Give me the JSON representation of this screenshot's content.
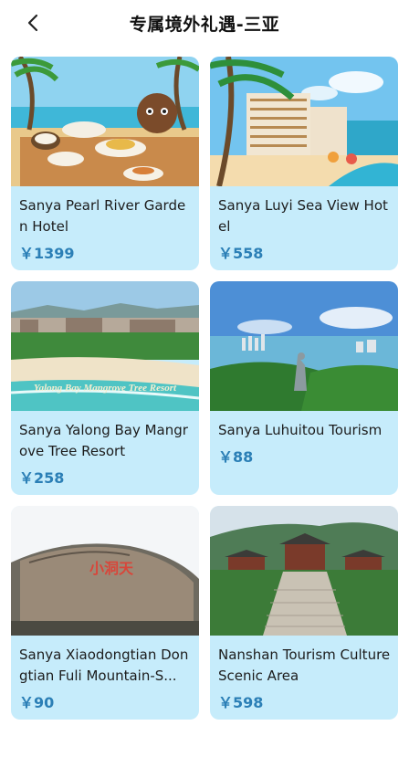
{
  "header": {
    "title": "专属境外礼遇-三亚"
  },
  "colors": {
    "card_bg": "#c6ecfb",
    "price": "#2b7fb6"
  },
  "hotels": [
    {
      "name": "Sanya Pearl River Garden Hotel",
      "price": "￥1399"
    },
    {
      "name": "Sanya Luyi Sea View Hotel",
      "price": "￥558"
    },
    {
      "name": "Sanya Yalong Bay Mangrove Tree Resort",
      "price": "￥258",
      "image_text": "Yalong Bay Mangrove Tree Resort"
    },
    {
      "name": "Sanya Luhuitou Tourism",
      "price": "￥88"
    },
    {
      "name": "Sanya Xiaodongtian Dongtian Fuli Mountain-S...",
      "price": "￥90",
      "image_text": "小洞天"
    },
    {
      "name": "Nanshan Tourism Culture Scenic Area",
      "price": "￥598"
    }
  ]
}
